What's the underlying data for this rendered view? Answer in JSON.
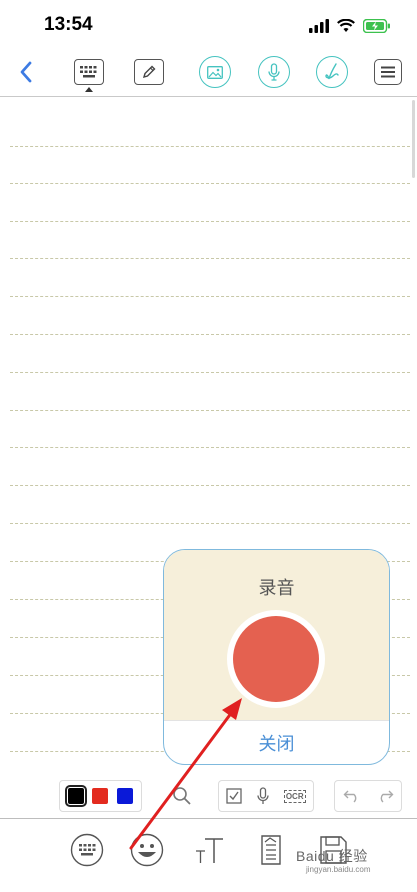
{
  "status_bar": {
    "time": "13:54",
    "battery_color": "#3cc14e"
  },
  "toolbar": {
    "items": [
      "back-icon",
      "keyboard-icon",
      "pen-edit-icon",
      "image-icon",
      "microphone-icon",
      "handwriting-icon",
      "menu-icon"
    ],
    "accent_color": "#45c3c0"
  },
  "recording_popup": {
    "title": "录音",
    "close_label": "关闭",
    "record_color": "#e46150",
    "background_color": "#f6efda"
  },
  "palette": {
    "colors": [
      "#000000",
      "#e32b1f",
      "#0a19d8"
    ],
    "selected": "#000000"
  },
  "tools": {
    "ocr_label": "OCR"
  },
  "bottom_bar": {
    "items": [
      "keyboard-icon",
      "emoji-icon",
      "text-size-icon",
      "document-icon",
      "save-icon"
    ]
  },
  "watermark": {
    "text": "Baidu 经验",
    "sub": "jingyan.baidu.com"
  },
  "annotation_arrow_color": "#e02020"
}
